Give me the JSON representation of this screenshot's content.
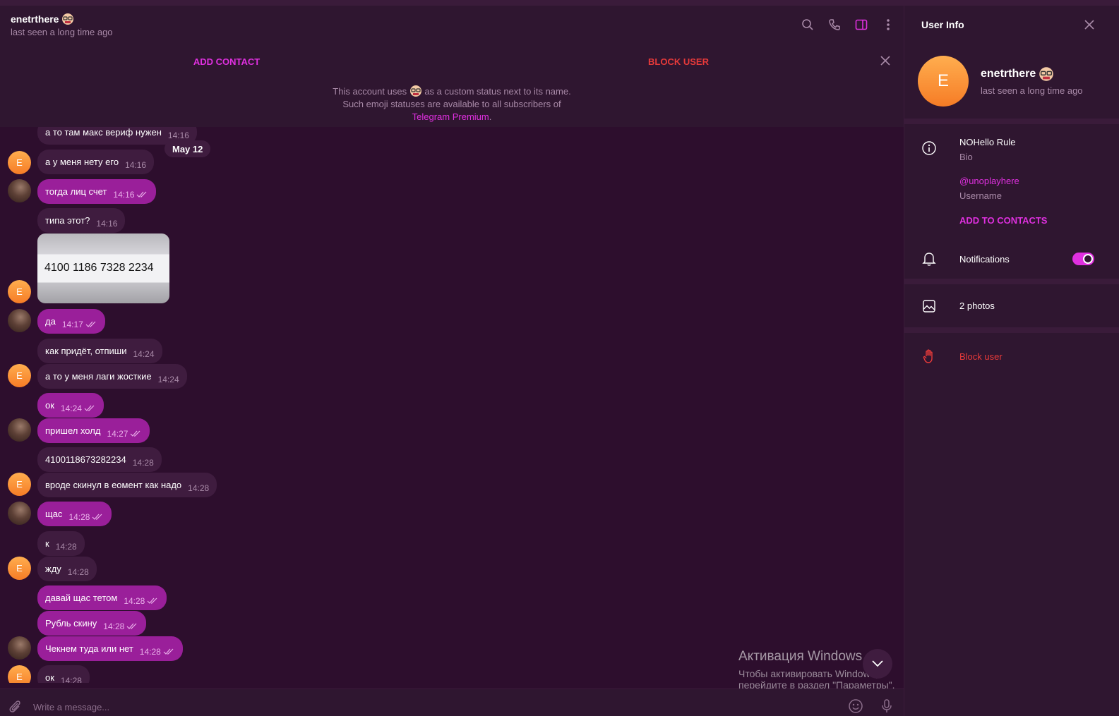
{
  "chat": {
    "name": "enetrthere",
    "status": "last seen a long time ago",
    "icons": [
      "search-icon",
      "phone-icon",
      "sidebar-toggle-icon",
      "more-icon"
    ]
  },
  "action_bar": {
    "add_contact": "ADD CONTACT",
    "block_user": "BLOCK USER",
    "note_before": "This account uses",
    "note_after": "as a custom status next to its name. Such emoji statuses are available to all subscribers of",
    "note_link": "Telegram Premium",
    "note_end": "."
  },
  "date_label": "May 12",
  "messages": [
    {
      "dir": "in",
      "text": "а то там макс вериф нужен",
      "time": "14:16"
    },
    {
      "dir": "in",
      "text": "а у меня нету его",
      "time": "14:16"
    },
    {
      "dir": "out",
      "text": "тогда лиц счет",
      "time": "14:16"
    },
    {
      "dir": "in",
      "text": "типа этот?",
      "time": "14:16"
    },
    {
      "dir": "img",
      "text": "4100 1186 7328 2234",
      "time": ""
    },
    {
      "dir": "out",
      "text": "да",
      "time": "14:17"
    },
    {
      "dir": "in",
      "text": "как придёт, отпиши",
      "time": "14:24"
    },
    {
      "dir": "in",
      "text": "а то у меня лаги жосткие",
      "time": "14:24"
    },
    {
      "dir": "out",
      "text": "ок",
      "time": "14:24"
    },
    {
      "dir": "out",
      "text": "пришел холд",
      "time": "14:27"
    },
    {
      "dir": "in",
      "text": "4100118673282234",
      "time": "14:28"
    },
    {
      "dir": "in",
      "text": "вроде скинул в еомент как надо",
      "time": "14:28"
    },
    {
      "dir": "out",
      "text": "щас",
      "time": "14:28"
    },
    {
      "dir": "in",
      "text": "к",
      "time": "14:28"
    },
    {
      "dir": "in",
      "text": "жду",
      "time": "14:28"
    },
    {
      "dir": "out",
      "text": "давай щас тетом",
      "time": "14:28"
    },
    {
      "dir": "out",
      "text": "Рубль скину",
      "time": "14:28"
    },
    {
      "dir": "out",
      "text": "Чекнем туда или нет",
      "time": "14:28"
    },
    {
      "dir": "in",
      "text": "ок",
      "time": "14:28"
    }
  ],
  "avatar_letter": "E",
  "composer": {
    "placeholder": "Write a message..."
  },
  "watermark": {
    "line1": "Активация Windows",
    "line2": "Чтобы активировать Windows, перейдите в раздел \"Параметры\"."
  },
  "panel": {
    "title": "User Info",
    "avatar_letter": "E",
    "name": "enetrthere",
    "status": "last seen a long time ago",
    "bio": "NOHello Rule",
    "bio_label": "Bio",
    "username": "@unoplayhere",
    "username_label": "Username",
    "add_to_contacts": "ADD TO CONTACTS",
    "notifications": "Notifications",
    "notifications_on": true,
    "photos": "2 photos",
    "block": "Block user"
  },
  "colors": {
    "accent": "#e030e0",
    "danger": "#e83a3a",
    "outgoing_bubble": "#9a1f9a",
    "incoming_bubble": "#3f1c3f",
    "background": "#2d0e2d"
  }
}
